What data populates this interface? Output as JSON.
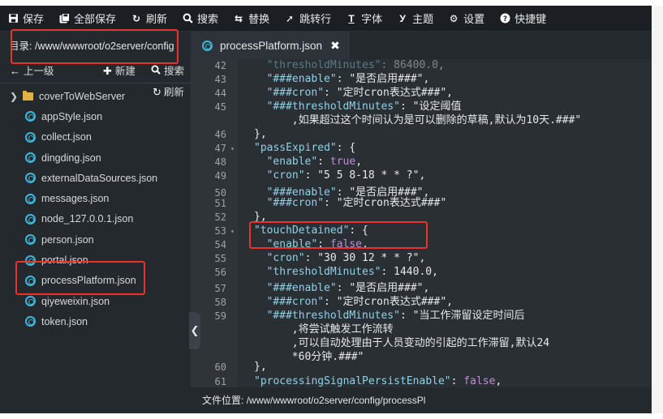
{
  "toolbar": {
    "items": [
      {
        "id": "save",
        "label": "保存",
        "icon": "save-icon"
      },
      {
        "id": "save-all",
        "label": "全部保存",
        "icon": "save-all-icon"
      },
      {
        "id": "refresh",
        "label": "刷新",
        "icon": "refresh-icon"
      },
      {
        "id": "search",
        "label": "搜索",
        "icon": "search-icon"
      },
      {
        "id": "replace",
        "label": "替换",
        "icon": "replace-icon"
      },
      {
        "id": "goto-line",
        "label": "跳转行",
        "icon": "pin-icon"
      },
      {
        "id": "font",
        "label": "字体",
        "icon": "font-icon"
      },
      {
        "id": "theme",
        "label": "主题",
        "icon": "theme-icon"
      },
      {
        "id": "settings",
        "label": "设置",
        "icon": "gear-icon"
      },
      {
        "id": "shortcuts",
        "label": "快捷键",
        "icon": "help-icon"
      }
    ]
  },
  "sidebar": {
    "dir_label": "目录:",
    "dir_path": "/www/wwwroot/o2server/config",
    "up_label": "上一级",
    "new_label": "新建",
    "search_label": "搜索",
    "refresh_label": "刷新",
    "tree": [
      {
        "name": "coverToWebServer",
        "type": "folder"
      },
      {
        "name": "appStyle.json",
        "type": "file"
      },
      {
        "name": "collect.json",
        "type": "file"
      },
      {
        "name": "dingding.json",
        "type": "file"
      },
      {
        "name": "externalDataSources.json",
        "type": "file"
      },
      {
        "name": "messages.json",
        "type": "file"
      },
      {
        "name": "node_127.0.0.1.json",
        "type": "file"
      },
      {
        "name": "person.json",
        "type": "file"
      },
      {
        "name": "portal.json",
        "type": "file"
      },
      {
        "name": "processPlatform.json",
        "type": "file"
      },
      {
        "name": "qiyeweixin.json",
        "type": "file"
      },
      {
        "name": "token.json",
        "type": "file"
      }
    ]
  },
  "editor": {
    "tab_label": "processPlatform.json",
    "status_label": "文件位置:",
    "status_path": "/www/wwwroot/o2server/config/processPl",
    "lines": [
      {
        "n": "42",
        "fold": false,
        "indent": 2,
        "tokens": [
          [
            "k",
            "\"thresholdMinutes\""
          ],
          [
            "p",
            ": "
          ],
          [
            "n",
            "86400.0"
          ],
          [
            "p",
            ","
          ]
        ]
      },
      {
        "n": "43",
        "fold": false,
        "indent": 2,
        "tokens": [
          [
            "k",
            "\"###enable\""
          ],
          [
            "p",
            ": "
          ],
          [
            "s",
            "\"是否启用###\""
          ],
          [
            "p",
            ","
          ]
        ]
      },
      {
        "n": "44",
        "fold": false,
        "indent": 2,
        "tokens": [
          [
            "k",
            "\"###cron\""
          ],
          [
            "p",
            ": "
          ],
          [
            "s",
            "\"定时cron表达式###\""
          ],
          [
            "p",
            ","
          ]
        ]
      },
      {
        "n": "45",
        "fold": false,
        "indent": 2,
        "tokens": [
          [
            "k",
            "\"###thresholdMinutes\""
          ],
          [
            "p",
            ": "
          ],
          [
            "s",
            "\"设定阈值"
          ]
        ]
      },
      {
        "n": "",
        "fold": false,
        "indent": 6,
        "tokens": [
          [
            "s",
            ",如果超过这个时间认为是可以删除的草稿,默认为10天.###\""
          ]
        ]
      },
      {
        "n": "46",
        "fold": false,
        "indent": 0,
        "tokens": [
          [
            "p",
            "},"
          ]
        ]
      },
      {
        "n": "47",
        "fold": true,
        "indent": 0,
        "tokens": [
          [
            "k",
            "\"passExpired\""
          ],
          [
            "p",
            ": {"
          ]
        ]
      },
      {
        "n": "48",
        "fold": false,
        "indent": 2,
        "tokens": [
          [
            "k",
            "\"enable\""
          ],
          [
            "p",
            ": "
          ],
          [
            "b",
            "true"
          ],
          [
            "p",
            ","
          ]
        ]
      },
      {
        "n": "49",
        "fold": false,
        "indent": 2,
        "tokens": [
          [
            "k",
            "\"cron\""
          ],
          [
            "p",
            ": "
          ],
          [
            "s",
            "\"5 5 8-18 * * ?\""
          ],
          [
            "p",
            ","
          ]
        ]
      },
      {
        "n": "50",
        "fold": false,
        "indent": 2,
        "tokens": [
          [
            "k",
            "\"###enable\""
          ],
          [
            "p",
            ": "
          ],
          [
            "s",
            "\"是否启用###\""
          ],
          [
            "p",
            ","
          ]
        ]
      },
      {
        "n": "51",
        "fold": false,
        "indent": 2,
        "tokens": [
          [
            "k",
            "\"###cron\""
          ],
          [
            "p",
            ": "
          ],
          [
            "s",
            "\"定时cron表达式###\""
          ]
        ]
      },
      {
        "n": "52",
        "fold": false,
        "indent": 0,
        "tokens": [
          [
            "p",
            "},"
          ]
        ]
      },
      {
        "n": "53",
        "fold": true,
        "indent": 0,
        "tokens": [
          [
            "k",
            "\"touchDetained\""
          ],
          [
            "p",
            ": {"
          ]
        ]
      },
      {
        "n": "54",
        "fold": false,
        "indent": 2,
        "tokens": [
          [
            "k",
            "\"enable\""
          ],
          [
            "p",
            ": "
          ],
          [
            "b",
            "false"
          ],
          [
            "p",
            ","
          ]
        ]
      },
      {
        "n": "55",
        "fold": false,
        "indent": 2,
        "tokens": [
          [
            "k",
            "\"cron\""
          ],
          [
            "p",
            ": "
          ],
          [
            "s",
            "\"30 30 12 * * ?\""
          ],
          [
            "p",
            ","
          ]
        ]
      },
      {
        "n": "56",
        "fold": false,
        "indent": 2,
        "tokens": [
          [
            "k",
            "\"thresholdMinutes\""
          ],
          [
            "p",
            ": "
          ],
          [
            "n",
            "1440.0"
          ],
          [
            "p",
            ","
          ]
        ]
      },
      {
        "n": "57",
        "fold": false,
        "indent": 2,
        "tokens": [
          [
            "k",
            "\"###enable\""
          ],
          [
            "p",
            ": "
          ],
          [
            "s",
            "\"是否启用###\""
          ],
          [
            "p",
            ","
          ]
        ]
      },
      {
        "n": "58",
        "fold": false,
        "indent": 2,
        "tokens": [
          [
            "k",
            "\"###cron\""
          ],
          [
            "p",
            ": "
          ],
          [
            "s",
            "\"定时cron表达式###\""
          ],
          [
            "p",
            ","
          ]
        ]
      },
      {
        "n": "59",
        "fold": false,
        "indent": 2,
        "tokens": [
          [
            "k",
            "\"###thresholdMinutes\""
          ],
          [
            "p",
            ": "
          ],
          [
            "s",
            "\"当工作滞留设定时间后"
          ]
        ]
      },
      {
        "n": "",
        "fold": false,
        "indent": 6,
        "tokens": [
          [
            "s",
            ",将尝试触发工作流转"
          ]
        ]
      },
      {
        "n": "",
        "fold": false,
        "indent": 6,
        "tokens": [
          [
            "s",
            ",可以自动处理由于人员变动的引起的工作滞留,默认24"
          ]
        ]
      },
      {
        "n": "",
        "fold": false,
        "indent": 6,
        "tokens": [
          [
            "s",
            "*60分钟.###\""
          ]
        ]
      },
      {
        "n": "60",
        "fold": false,
        "indent": 0,
        "tokens": [
          [
            "p",
            "},"
          ]
        ]
      },
      {
        "n": "61",
        "fold": false,
        "indent": 0,
        "tokens": [
          [
            "k",
            "\"processingSignalPersistEnable\""
          ],
          [
            "p",
            ": "
          ],
          [
            "b",
            "false"
          ],
          [
            "p",
            ","
          ]
        ]
      }
    ]
  },
  "colors": {
    "toolbar_bg": "#1b1f23",
    "sidebar_bg": "#24292e",
    "editor_bg": "#2a2f34",
    "gutter_bg": "#2f3438",
    "key": "#8fd2e8",
    "boolean": "#c08cd8",
    "file_icon": "#3fb5d8",
    "folder_icon": "#e5b143",
    "highlight": "#e8332b"
  }
}
